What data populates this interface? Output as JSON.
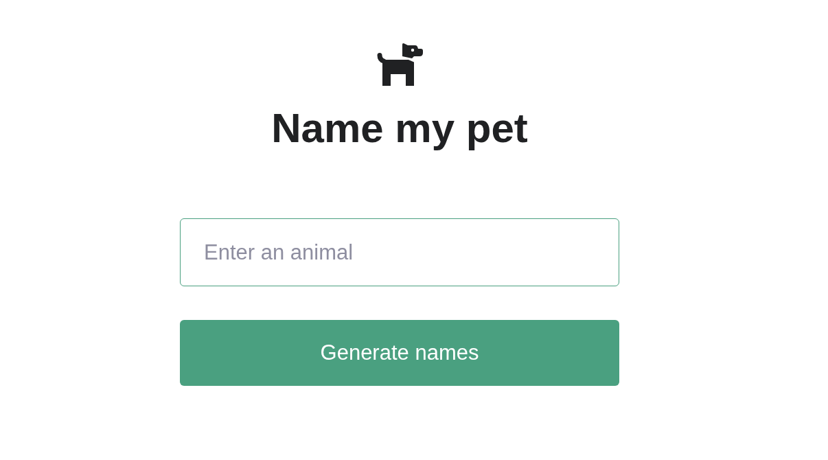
{
  "heading": "Name my pet",
  "animal_field": {
    "placeholder": "Enter an animal"
  },
  "submit_button": {
    "label": "Generate names"
  }
}
